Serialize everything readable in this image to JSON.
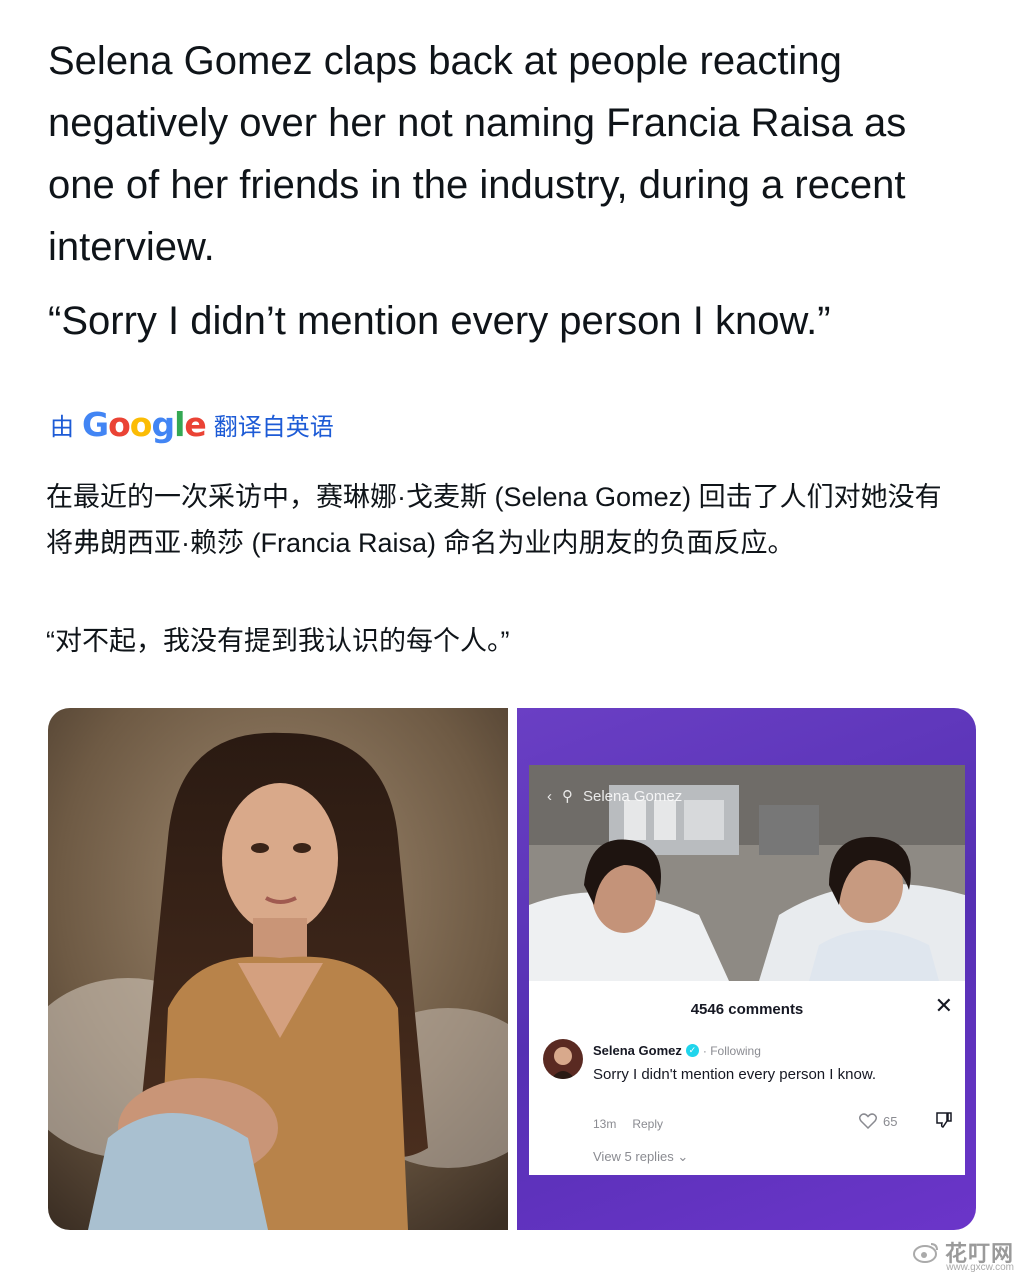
{
  "tweet": {
    "text": "Selena Gomez claps back at people reacting negatively over her not naming Francia Raisa as one of her friends in the industry, during a recent interview.",
    "quote": "“Sorry I didn’t mention every person I know.”"
  },
  "translation": {
    "prefix": "由",
    "provider_letters": [
      "G",
      "o",
      "o",
      "g",
      "l",
      "e"
    ],
    "suffix": "翻译自英语",
    "text": "在最近的一次采访中，赛琳娜·戈麦斯 (Selena Gomez) 回击了人们对她没有将弗朗西亚·赖莎 (Francia Raisa) 命名为业内朋友的负面反应。",
    "quote": "“对不起，我没有提到我认识的每个人。”"
  },
  "screenshot": {
    "search_text": "Selena Gomez",
    "comments_count": "4546 comments",
    "comment": {
      "author": "Selena Gomez",
      "following": "· Following",
      "text": "Sorry I didn't mention every person I know.",
      "time": "13m",
      "reply_label": "Reply",
      "likes": "65",
      "view_replies": "View 5 replies"
    }
  },
  "watermark": {
    "name": "花叮网",
    "url": "www.gxcw.com"
  },
  "colors": {
    "link_blue": "#1d5bd6",
    "purple_bg": "#5a33b8",
    "tiktok_verified": "#20d5ec"
  }
}
